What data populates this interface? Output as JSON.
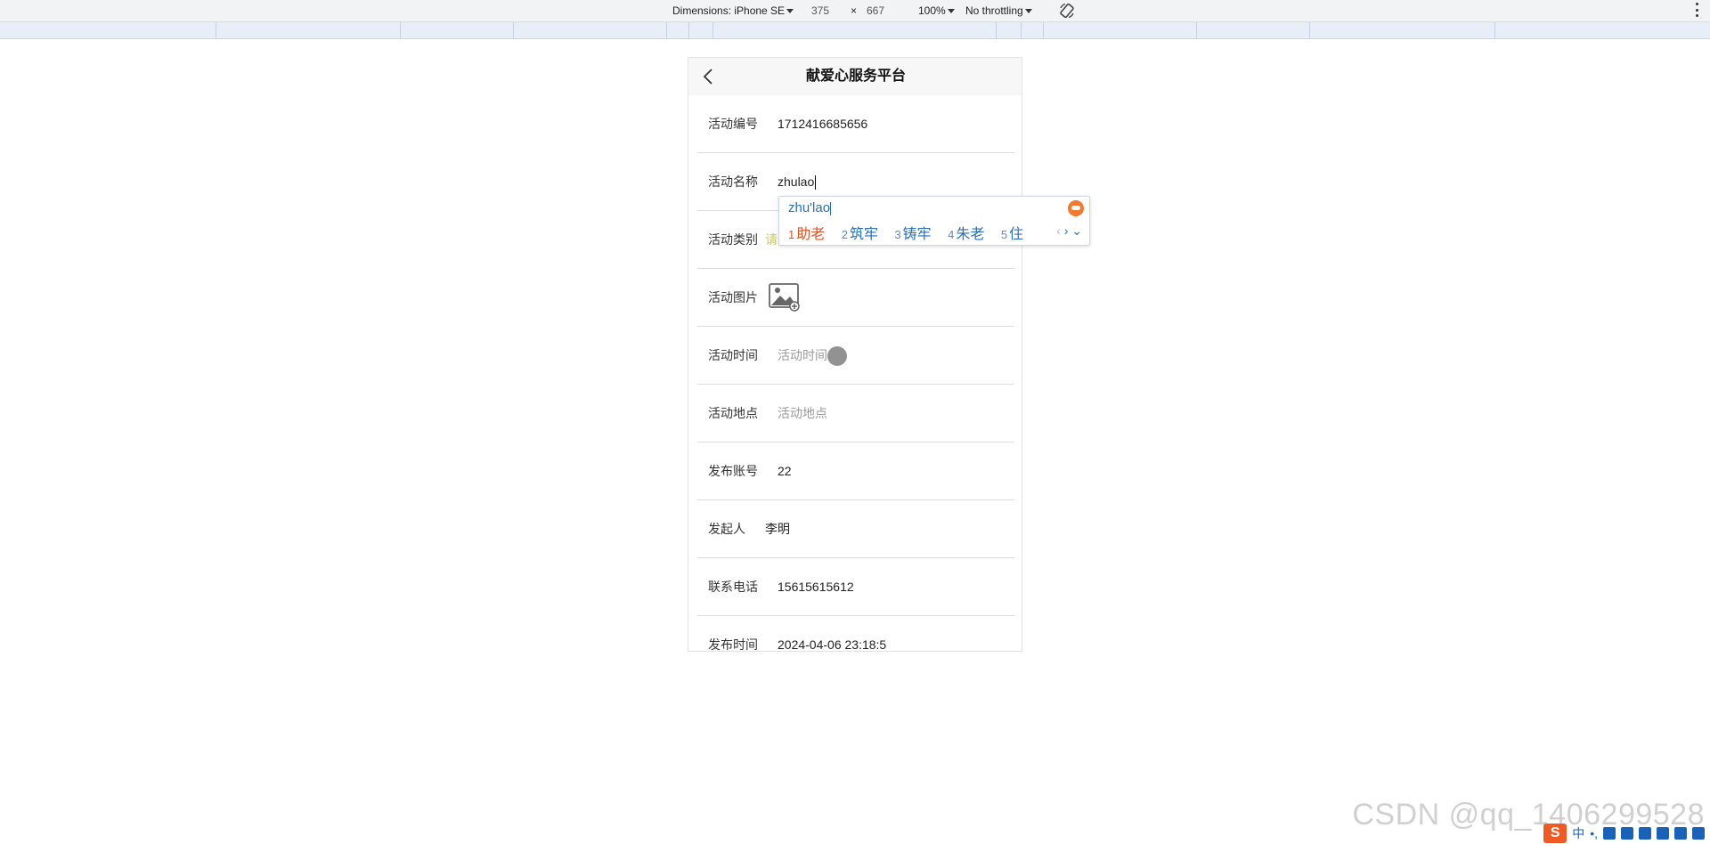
{
  "devtools": {
    "dimensions_label": "Dimensions: iPhone SE",
    "width": "375",
    "times": "×",
    "height": "667",
    "zoom": "100%",
    "throttle": "No throttling"
  },
  "app": {
    "title": "献爱心服务平台",
    "fields": [
      {
        "label": "活动编号",
        "value": "1712416685656"
      },
      {
        "label": "活动名称",
        "value": "zhulao"
      },
      {
        "label": "活动类别",
        "placeholder": "请选择活动类别"
      },
      {
        "label": "活动图片"
      },
      {
        "label": "活动时间",
        "placeholder": "活动时间"
      },
      {
        "label": "活动地点",
        "placeholder": "活动地点"
      },
      {
        "label": "发布账号",
        "value": "22"
      },
      {
        "label": "发起人",
        "value": "李明"
      },
      {
        "label": "联系电话",
        "value": "15615615612"
      },
      {
        "label": "发布时间",
        "value": "2024-04-06 23:18:5"
      }
    ]
  },
  "ime": {
    "composition": "zhu'lao",
    "candidates": [
      {
        "num": "1",
        "text": "助老"
      },
      {
        "num": "2",
        "text": "筑牢"
      },
      {
        "num": "3",
        "text": "铸牢"
      },
      {
        "num": "4",
        "text": "朱老"
      },
      {
        "num": "5",
        "text": "住"
      }
    ],
    "prev": "‹",
    "next": "›",
    "expand": "⌄"
  },
  "watermark": "CSDN @qq_1406299528",
  "ime_bar": {
    "logo": "S",
    "mode": "中",
    "punct": "•,"
  },
  "colors": {
    "accent": "#2a6fb8",
    "first_candidate": "#e0542a",
    "select_placeholder": "#c8c86a"
  }
}
